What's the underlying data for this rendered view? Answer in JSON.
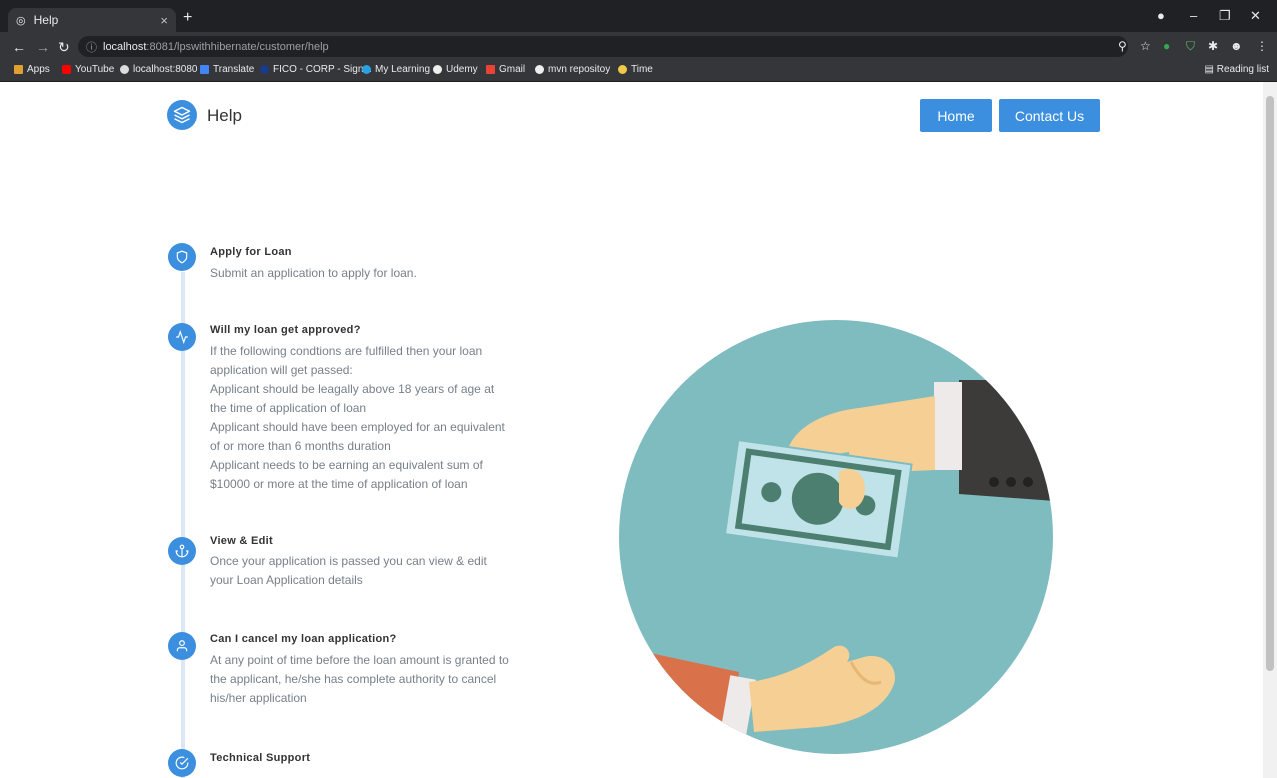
{
  "browser": {
    "tab_title": "Help",
    "tab_close": "×",
    "new_tab": "+",
    "url_host": "localhost",
    "url_rest": ":8081/lpswithhibernate/customer/help",
    "bookmarks": [
      "Apps",
      "YouTube",
      "localhost:8080",
      "Translate",
      "FICO - CORP - Sign...",
      "My Learning",
      "Udemy",
      "Gmail",
      "mvn repositoy",
      "Time"
    ],
    "reading_list": "Reading list"
  },
  "header": {
    "brand": "Help",
    "home_label": "Home",
    "contact_label": "Contact Us"
  },
  "timeline": [
    {
      "title": "Apply for Loan",
      "body": "Submit an application to apply for loan.",
      "icon": "shield-icon"
    },
    {
      "title": "Will my loan get approved?",
      "body": "If the following condtions are fulfilled then your loan application will get passed:\nApplicant should be leagally above 18 years of age at the time of application of loan\nApplicant should have been employed for an equivalent of or more than 6 months duration\nApplicant needs to be earning an equivalent sum of $10000 or more at the time of application of loan",
      "icon": "activity-icon"
    },
    {
      "title": "View & Edit",
      "body": "Once your application is passed you can view & edit your Loan Application details",
      "icon": "anchor-icon"
    },
    {
      "title": "Can I cancel my loan application?",
      "body": "At any point of time before the loan amount is granted to the applicant, he/she has complete authority to cancel his/her application",
      "icon": "user-icon"
    },
    {
      "title": "Technical Support",
      "body": "",
      "icon": "check-circle-icon"
    }
  ],
  "colors": {
    "accent": "#3b8fde",
    "circle": "#7fbcbf"
  }
}
